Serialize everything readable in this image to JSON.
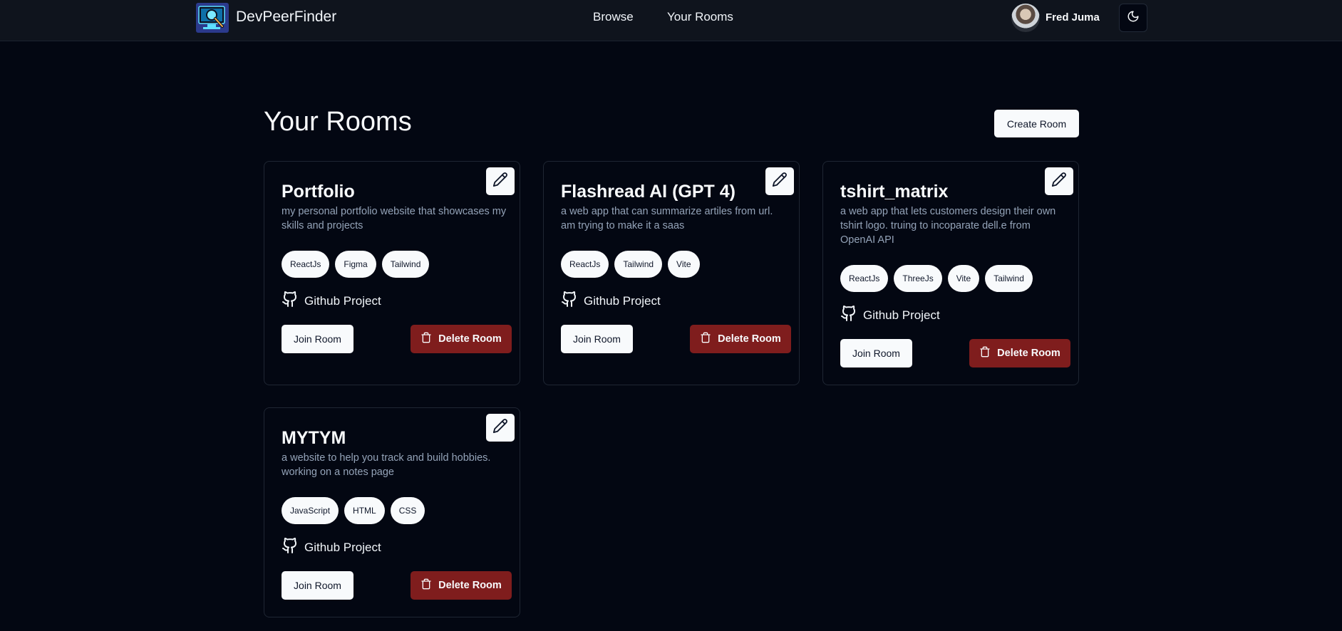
{
  "app": {
    "brand": "DevPeerFinder"
  },
  "nav": {
    "browse": "Browse",
    "your_rooms": "Your Rooms"
  },
  "user": {
    "name": "Fred Juma"
  },
  "page": {
    "title": "Your Rooms",
    "create_label": "Create Room"
  },
  "rooms": [
    {
      "title": "Portfolio",
      "description": "my personal portfolio website that showcases my skills and projects",
      "tags": [
        "ReactJs",
        "Figma",
        "Tailwind"
      ],
      "github_label": "Github Project",
      "join_label": "Join Room",
      "delete_label": "Delete Room"
    },
    {
      "title": "Flashread AI (GPT 4)",
      "description": "a web app that can summarize artiles from url. am trying to make it a saas",
      "tags": [
        "ReactJs",
        "Tailwind",
        "Vite"
      ],
      "github_label": "Github Project",
      "join_label": "Join Room",
      "delete_label": "Delete Room"
    },
    {
      "title": "tshirt_matrix",
      "description": "a web app that lets customers design their own tshirt logo. truing to incoparate dell.e from OpenAI API",
      "tags": [
        "ReactJs",
        "ThreeJs",
        "Vite",
        "Tailwind"
      ],
      "github_label": "Github Project",
      "join_label": "Join Room",
      "delete_label": "Delete Room"
    },
    {
      "title": "MYTYM",
      "description": "a website to help you track and build hobbies. working on a notes page",
      "tags": [
        "JavaScript",
        "HTML",
        "CSS"
      ],
      "github_label": "Github Project",
      "join_label": "Join Room",
      "delete_label": "Delete Room"
    }
  ],
  "icons": {
    "logo": "monitor-magnifier-logo",
    "theme": "moon-icon",
    "edit": "pencil-icon",
    "github": "github-icon",
    "delete": "trash-icon"
  },
  "colors": {
    "background": "#030712",
    "header": "#0f141d",
    "delete": "#7f1d1d",
    "muted_text": "#94a3b8"
  }
}
